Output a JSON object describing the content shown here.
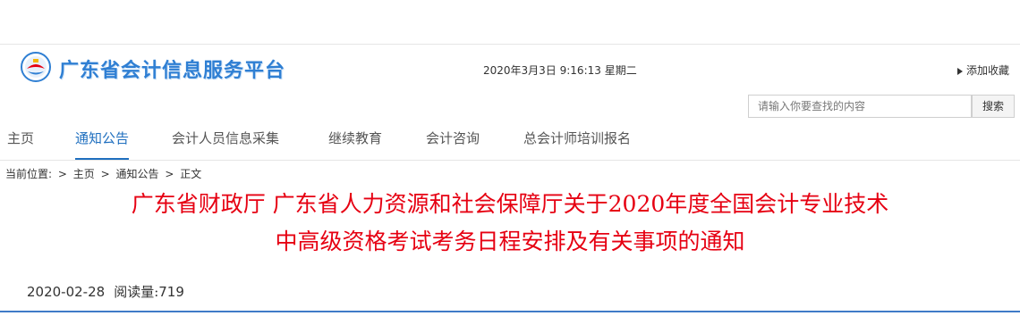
{
  "header": {
    "logo_text": "广东省会计信息服务平台",
    "datetime": "2020年3月3日 9:16:13 星期二",
    "favorite_label": "添加收藏"
  },
  "search": {
    "placeholder": "请输入你要查找的内容",
    "button_label": "搜索"
  },
  "nav": {
    "items": [
      {
        "label": "主页"
      },
      {
        "label": "通知公告"
      },
      {
        "label": "会计人员信息采集"
      },
      {
        "label": "继续教育"
      },
      {
        "label": "会计咨询"
      },
      {
        "label": "总会计师培训报名"
      }
    ],
    "active_index": 1
  },
  "breadcrumb": {
    "prefix": "当前位置:",
    "items": [
      "主页",
      "通知公告",
      "正文"
    ],
    "separator": ">"
  },
  "article": {
    "title_line1": "广东省财政厅 广东省人力资源和社会保障厅关于2020年度全国会计专业技术",
    "title_line2": "中高级资格考试考务日程安排及有关事项的通知",
    "date": "2020-02-28",
    "views_label": "阅读量:",
    "views": "719"
  },
  "colors": {
    "accent": "#1f6fbf",
    "title_red": "#e60012",
    "logo_blue": "#2f7fd3"
  },
  "icons": {
    "logo": "provincial-emblem-icon",
    "favorite": "triangle-right-icon"
  }
}
